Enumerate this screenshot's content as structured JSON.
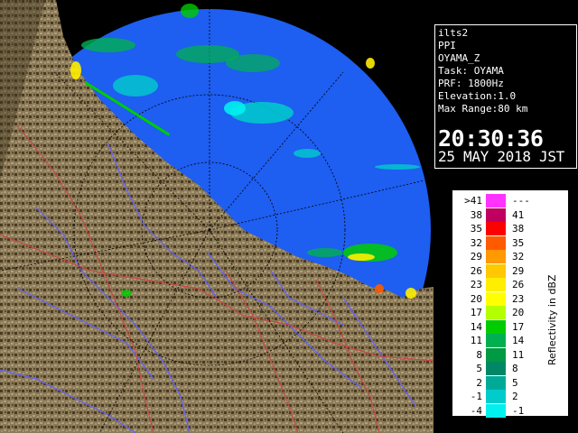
{
  "info": {
    "lines": [
      "ilts2",
      "PPI",
      "OYAMA_Z",
      "Task: OYAMA",
      "PRF: 1800Hz",
      "Elevation:1.0",
      "Max Range:80 km"
    ],
    "time": "20:30:36",
    "date": "25 MAY 2018 JST"
  },
  "legend": {
    "title": "Reflectivity in dBZ",
    "rows": [
      {
        "low": ">41",
        "high": "---",
        "color": "#ff33ff"
      },
      {
        "low": "38",
        "high": "41",
        "color": "#c00060"
      },
      {
        "low": "35",
        "high": "38",
        "color": "#ff0000"
      },
      {
        "low": "32",
        "high": "35",
        "color": "#ff5a00"
      },
      {
        "low": "29",
        "high": "32",
        "color": "#ff9900"
      },
      {
        "low": "26",
        "high": "29",
        "color": "#ffc800"
      },
      {
        "low": "23",
        "high": "26",
        "color": "#ffee00"
      },
      {
        "low": "20",
        "high": "23",
        "color": "#ffff00"
      },
      {
        "low": "17",
        "high": "20",
        "color": "#b4ff00"
      },
      {
        "low": "14",
        "high": "17",
        "color": "#00cc00"
      },
      {
        "low": "11",
        "high": "14",
        "color": "#00b050"
      },
      {
        "low": "8",
        "high": "11",
        "color": "#009944"
      },
      {
        "low": "5",
        "high": "8",
        "color": "#008866"
      },
      {
        "low": "2",
        "high": "5",
        "color": "#00aa99"
      },
      {
        "low": "-1",
        "high": "2",
        "color": "#00cccc"
      },
      {
        "low": "-4",
        "high": "-1",
        "color": "#00f0f0"
      }
    ]
  },
  "colors": {
    "sea": "#1e5ef0",
    "land": "#8a7a58",
    "rivers": "#6060ff",
    "borders": "#d04040"
  }
}
